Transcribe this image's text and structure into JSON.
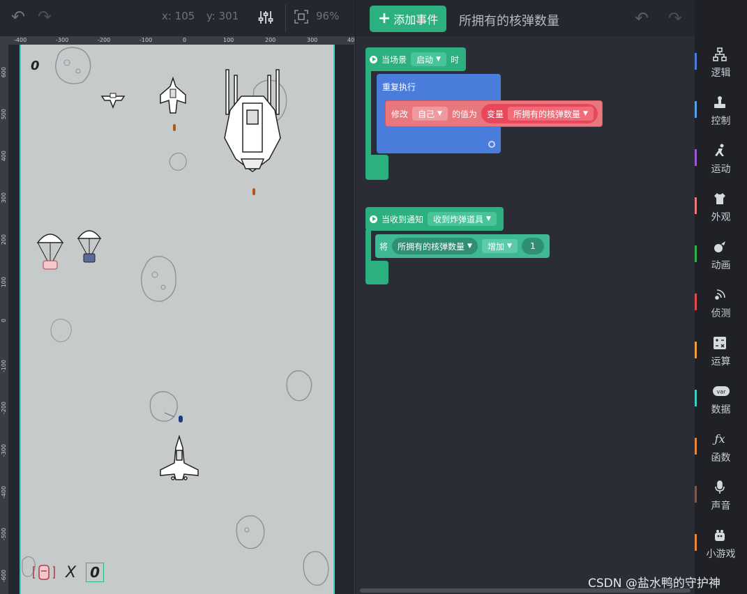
{
  "stage": {
    "toolbar": {
      "x_label": "x: 105",
      "y_label": "y: 301",
      "zoom": "96%"
    },
    "ruler_top": [
      "-400",
      "-300",
      "-200",
      "-100",
      "0",
      "100",
      "200",
      "300",
      "40"
    ],
    "ruler_left": [
      "600",
      "500",
      "400",
      "300",
      "200",
      "100",
      "0",
      "-100",
      "-200",
      "-300",
      "-400",
      "-500",
      "-600"
    ],
    "score": "0",
    "bomb_x": "X",
    "bomb_count": "0"
  },
  "code": {
    "add_event_label": "添加事件",
    "title": "所拥有的核弹数量",
    "when_scene": {
      "label": "当场景",
      "dropdown": "启动",
      "suffix": "时"
    },
    "repeat_label": "重复执行",
    "modify": {
      "label": "修改",
      "target": "自己",
      "value_label": "的值为",
      "var_label": "变量",
      "var_name": "所拥有的核弹数量"
    },
    "when_receive": {
      "label": "当收到通知",
      "dropdown": "收到炸弹道具"
    },
    "set": {
      "label": "将",
      "var_name": "所拥有的核弹数量",
      "op": "增加",
      "value": "1"
    }
  },
  "categories": [
    {
      "label": "逻辑",
      "icon": "logic-icon",
      "color": "#4a7cdc"
    },
    {
      "label": "控制",
      "icon": "control-icon",
      "color": "#5aa0e0"
    },
    {
      "label": "运动",
      "icon": "motion-icon",
      "color": "#9b59d0"
    },
    {
      "label": "外观",
      "icon": "appearance-icon",
      "color": "#e9777e"
    },
    {
      "label": "动画",
      "icon": "animation-icon",
      "color": "#2db04a"
    },
    {
      "label": "侦测",
      "icon": "sensing-icon",
      "color": "#e04a4a"
    },
    {
      "label": "运算",
      "icon": "operator-icon",
      "color": "#e8a040"
    },
    {
      "label": "数据",
      "icon": "data-icon",
      "color": "#3ecdc0"
    },
    {
      "label": "函数",
      "icon": "function-icon",
      "color": "#e8873a"
    },
    {
      "label": "声音",
      "icon": "sound-icon",
      "color": "#7a5a50"
    },
    {
      "label": "小游戏",
      "icon": "minigame-icon",
      "color": "#e8873a"
    }
  ],
  "watermark": "CSDN @盐水鸭的守护神"
}
